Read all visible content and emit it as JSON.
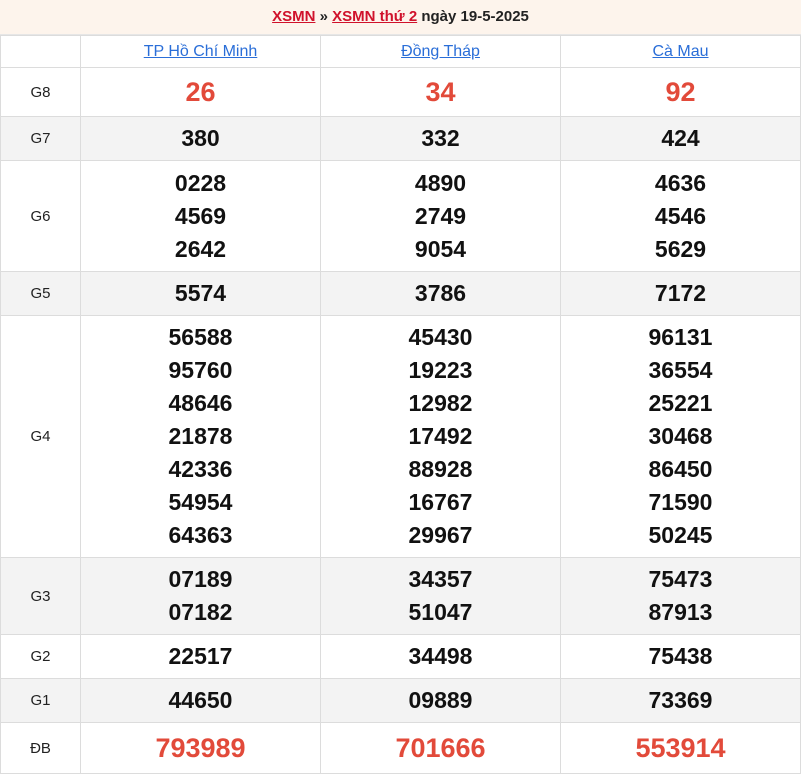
{
  "header": {
    "link1": "XSMN",
    "sep": " » ",
    "link2": "XSMN thứ 2",
    "date_text": " ngày 19-5-2025"
  },
  "provinces": [
    "TP Hồ Chí Minh",
    "Đồng Tháp",
    "Cà Mau"
  ],
  "prizes": [
    {
      "name": "G8",
      "big": true,
      "shaded": false,
      "values": [
        [
          "26"
        ],
        [
          "34"
        ],
        [
          "92"
        ]
      ]
    },
    {
      "name": "G7",
      "big": false,
      "shaded": true,
      "values": [
        [
          "380"
        ],
        [
          "332"
        ],
        [
          "424"
        ]
      ]
    },
    {
      "name": "G6",
      "big": false,
      "shaded": false,
      "values": [
        [
          "0228",
          "4569",
          "2642"
        ],
        [
          "4890",
          "2749",
          "9054"
        ],
        [
          "4636",
          "4546",
          "5629"
        ]
      ]
    },
    {
      "name": "G5",
      "big": false,
      "shaded": true,
      "values": [
        [
          "5574"
        ],
        [
          "3786"
        ],
        [
          "7172"
        ]
      ]
    },
    {
      "name": "G4",
      "big": false,
      "shaded": false,
      "values": [
        [
          "56588",
          "95760",
          "48646",
          "21878",
          "42336",
          "54954",
          "64363"
        ],
        [
          "45430",
          "19223",
          "12982",
          "17492",
          "88928",
          "16767",
          "29967"
        ],
        [
          "96131",
          "36554",
          "25221",
          "30468",
          "86450",
          "71590",
          "50245"
        ]
      ]
    },
    {
      "name": "G3",
      "big": false,
      "shaded": true,
      "values": [
        [
          "07189",
          "07182"
        ],
        [
          "34357",
          "51047"
        ],
        [
          "75473",
          "87913"
        ]
      ]
    },
    {
      "name": "G2",
      "big": false,
      "shaded": false,
      "values": [
        [
          "22517"
        ],
        [
          "34498"
        ],
        [
          "75438"
        ]
      ]
    },
    {
      "name": "G1",
      "big": false,
      "shaded": true,
      "values": [
        [
          "44650"
        ],
        [
          "09889"
        ],
        [
          "73369"
        ]
      ]
    },
    {
      "name": "ĐB",
      "big": true,
      "shaded": false,
      "values": [
        [
          "793989"
        ],
        [
          "701666"
        ],
        [
          "553914"
        ]
      ]
    }
  ],
  "colors": {
    "accent": "#d0112b",
    "highlight_number": "#e24a3a",
    "link": "#2a6ed8",
    "shade": "#f3f3f3"
  }
}
